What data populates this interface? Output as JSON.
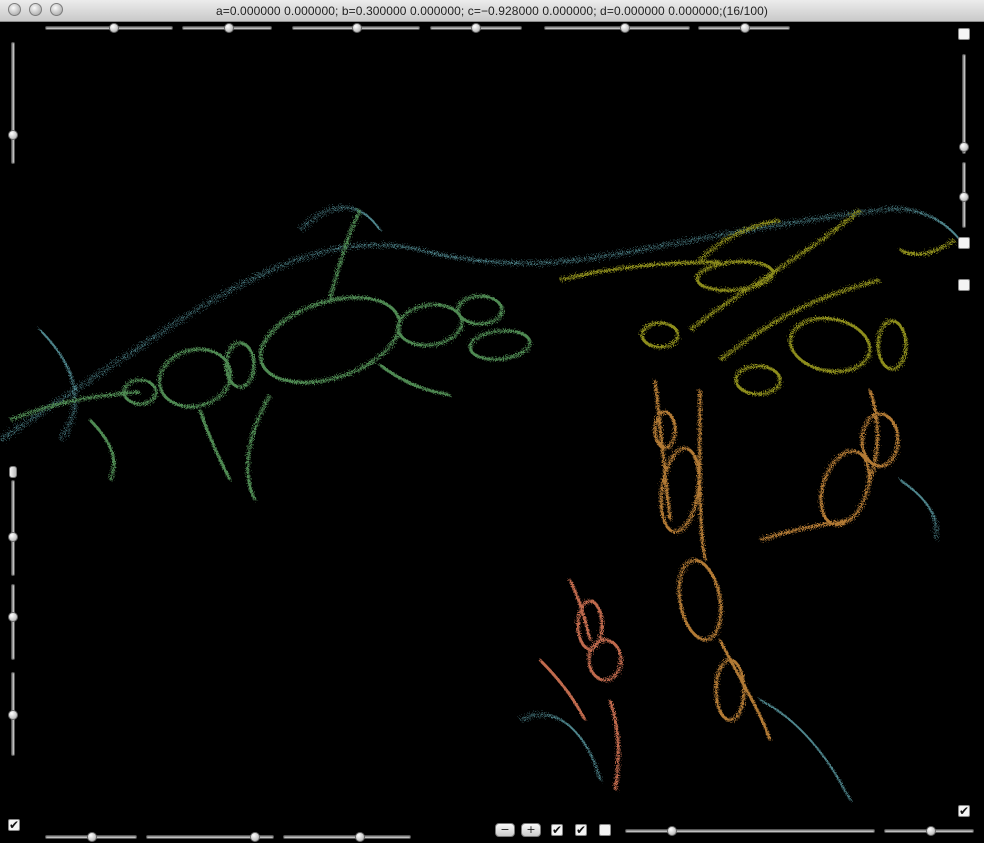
{
  "window": {
    "title": "a=0.000000 0.000000; b=0.300000 0.000000; c=−0.928000 0.000000; d=0.000000 0.000000;(16/100)"
  },
  "controls": {
    "zoom_out_label": "−",
    "zoom_in_label": "+",
    "check_mark": "✔"
  },
  "colors": {
    "background": "#000000",
    "fractal_green": "#4f8a52",
    "fractal_olive": "#8d8d1d",
    "fractal_orange": "#b27a34",
    "fractal_salmon": "#c06a4e",
    "fringe_cyan": "#8ff3ff"
  }
}
